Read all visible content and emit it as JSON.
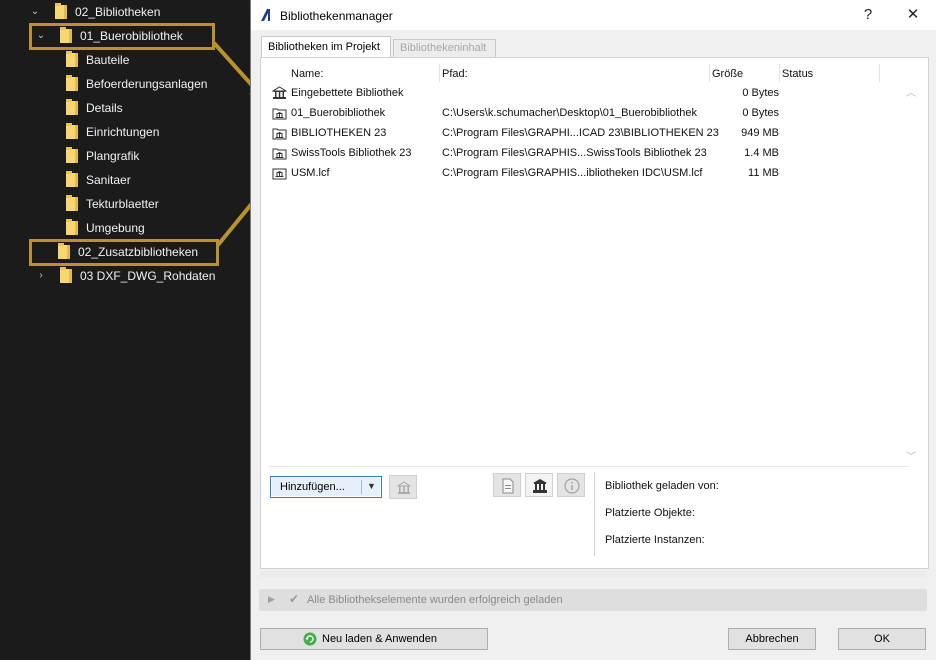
{
  "tree": {
    "items": [
      {
        "label": "02_Bibliotheken",
        "state": "expanded"
      },
      {
        "label": "01_Buerobibliothek",
        "state": "expanded"
      },
      {
        "label": "Bauteile"
      },
      {
        "label": "Befoerderungsanlagen"
      },
      {
        "label": "Details"
      },
      {
        "label": "Einrichtungen"
      },
      {
        "label": "Plangrafik"
      },
      {
        "label": "Sanitaer"
      },
      {
        "label": "Tekturblaetter"
      },
      {
        "label": "Umgebung"
      },
      {
        "label": "02_Zusatzbibliotheken"
      },
      {
        "label": "03 DXF_DWG_Rohdaten",
        "state": "collapsed"
      }
    ]
  },
  "dialog": {
    "title": "Bibliothekenmanager",
    "help_glyph": "?",
    "close_glyph": "✕",
    "tabs": [
      {
        "label": "Bibliotheken im Projekt",
        "active": true
      },
      {
        "label": "Bibliothekeninhalt",
        "active": false
      }
    ],
    "columns": {
      "name": "Name:",
      "path": "Pfad:",
      "size": "Größe",
      "status": "Status"
    },
    "rows": [
      {
        "name": "Eingebettete Bibliothek",
        "path": "",
        "size": "0 Bytes"
      },
      {
        "name": "01_Buerobibliothek",
        "path": "C:\\Users\\k.schumacher\\Desktop\\01_Buerobibliothek",
        "size": "0 Bytes"
      },
      {
        "name": "BIBLIOTHEKEN 23",
        "path": "C:\\Program Files\\GRAPHI...ICAD 23\\BIBLIOTHEKEN 23",
        "size": "949 MB"
      },
      {
        "name": "SwissTools Bibliothek 23",
        "path": "C:\\Program Files\\GRAPHIS...SwissTools Bibliothek 23",
        "size": "1.4 MB"
      },
      {
        "name": "USM.lcf",
        "path": "C:\\Program Files\\GRAPHIS...ibliotheken IDC\\USM.lcf",
        "size": "11 MB"
      }
    ],
    "add_button": "Hinzufügen...",
    "info": {
      "loaded_from": "Bibliothek geladen von:",
      "placed_objects": "Platzierte Objekte:",
      "placed_instances": "Platzierte Instanzen:"
    },
    "status_message": "Alle Bibliothekselemente wurden erfolgreich geladen",
    "buttons": {
      "reload": "Neu laden & Anwenden",
      "cancel": "Abbrechen",
      "ok": "OK"
    }
  },
  "colors": {
    "highlight": "#b8922f",
    "folder": "#f7d774",
    "accent": "#2f7fd5"
  }
}
